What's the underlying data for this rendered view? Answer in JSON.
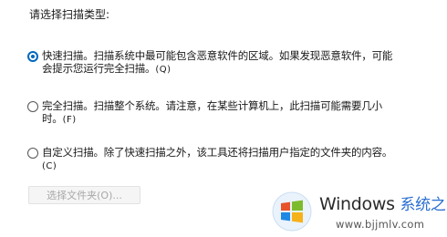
{
  "prompt": "请选择扫描类型:",
  "options": [
    {
      "line1": "快速扫描。扫描系统中最可能包含恶意软件的区域。如果发现恶意软件，可能",
      "line2": "会提示您运行完全扫描。",
      "hotkey": "(Q)",
      "checked": true
    },
    {
      "line1": "完全扫描。扫描整个系统。请注意，在某些计算机上，此扫描可能需要几小",
      "line2": "时。",
      "hotkey": "(F)",
      "checked": false
    },
    {
      "line1": "自定义扫描。除了快速扫描之外，该工具还将扫描用户指定的文件夹的内容。",
      "line2": "",
      "hotkey": "(C)",
      "checked": false
    }
  ],
  "choose_folder_button": "选择文件夹(O)...",
  "watermark": {
    "brand": "Windows",
    "brand_cn": "系统之家",
    "url": "www.bjjmlv.com"
  }
}
